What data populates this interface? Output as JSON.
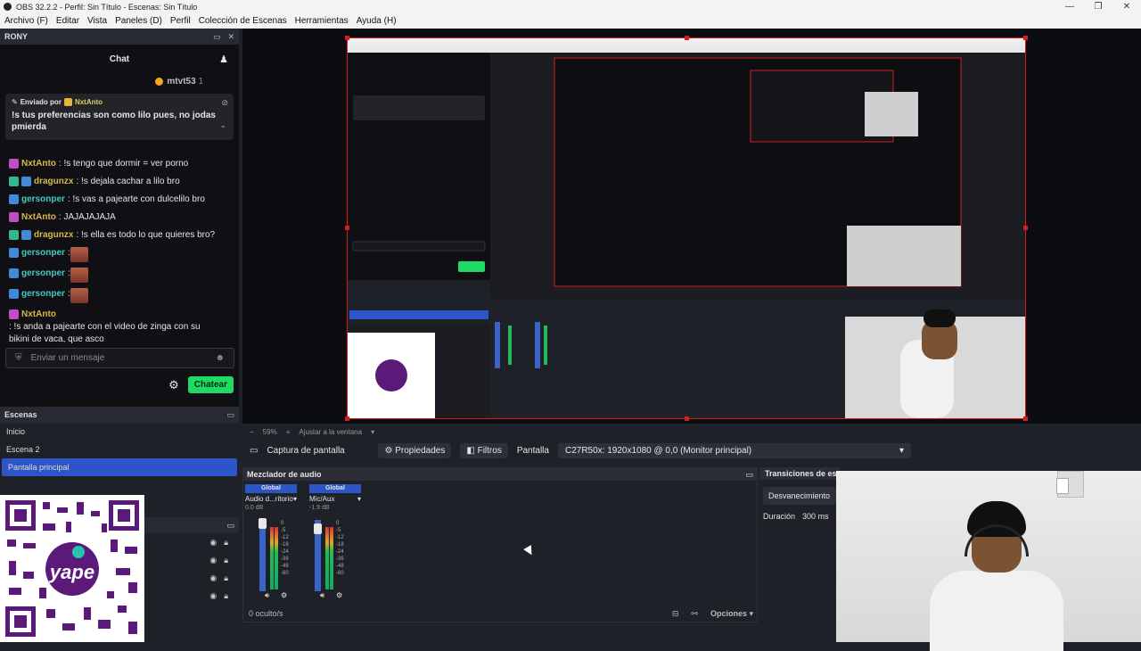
{
  "window": {
    "title": "OBS 32.2.2 - Perfil: Sin Título - Escenas: Sin Título",
    "controls": [
      "—",
      "❐",
      "✕"
    ]
  },
  "menu": [
    "Archivo (F)",
    "Editar",
    "Vista",
    "Paneles (D)",
    "Perfil",
    "Colección de Escenas",
    "Herramientas",
    "Ayuda (H)"
  ],
  "chat_dock": {
    "name": "RONY",
    "title": "Chat",
    "points_user": "mtvt53",
    "points_value": "1",
    "pinned": {
      "label": "Enviado por",
      "user": "NxtAnto",
      "text": "!s tus preferencias son como lilo pues, no jodas pmierda"
    },
    "messages": [
      {
        "user": "NxtAnto",
        "text": ": !s tengo que dormir = ver porno"
      },
      {
        "user": "dragunzx",
        "text": ": !s dejala cachar a lilo bro"
      },
      {
        "user": "gersonper",
        "text": ": !s vas a pajearte con dulcelilo bro"
      },
      {
        "user": "NxtAnto",
        "text": ": JAJAJAJAJA"
      },
      {
        "user": "dragunzx",
        "text": ": !s ella es todo lo que quieres bro?"
      },
      {
        "user": "gersonper",
        "text": ":"
      },
      {
        "user": "gersonper",
        "text": ":"
      },
      {
        "user": "gersonper",
        "text": ":"
      },
      {
        "user": "NxtAnto",
        "text": ": !s anda a pajearte con el video de zinga con su bikini de vaca, que asco"
      }
    ],
    "input_placeholder": "Enviar un mensaje",
    "send_label": "Chatear"
  },
  "scenes": {
    "title": "Escenas",
    "items": [
      "Inicio",
      "Escena 2",
      "Pantalla principal"
    ],
    "selected": "Pantalla principal"
  },
  "preview_controls": {
    "zoom": "59%",
    "fit": "Ajustar a la ventana"
  },
  "source_bar": {
    "source_name": "Captura de pantalla",
    "properties": "Propiedades",
    "filters": "Filtros",
    "display_label": "Pantalla",
    "display_value": "C27R50x: 1920x1080 @ 0,0 (Monitor principal)"
  },
  "mixer": {
    "title": "Mezclador de audio",
    "channels": [
      {
        "scope": "Global",
        "name": "Audio d...ritorio",
        "db": "0.0 dB"
      },
      {
        "scope": "Global",
        "name": "Mic/Aux",
        "db": "-1.9 dB"
      }
    ],
    "scale": [
      "0",
      "-5",
      "-12",
      "-18",
      "-24",
      "-36",
      "-48",
      "-60"
    ],
    "hidden_count": "0 oculto/s",
    "options": "Opciones"
  },
  "transitions": {
    "title": "Transiciones de escena",
    "type": "Desvanecimiento",
    "duration_label": "Duración",
    "duration_value": "300 ms"
  },
  "colors": {
    "accent": "#2d55c8",
    "send": "#1fdb63",
    "selection_red": "#d21e1e"
  }
}
